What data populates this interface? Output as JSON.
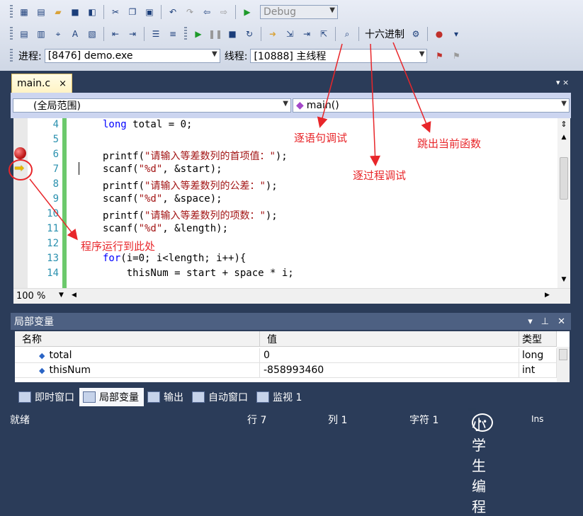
{
  "toolbar": {
    "config_value": "Debug",
    "hex_label": "十六进制",
    "process_label": "进程:",
    "process_value": "[8476] demo.exe",
    "thread_label": "线程:",
    "thread_value": "[10888] 主线程"
  },
  "editor": {
    "tab_label": "main.c",
    "tab_close": "×",
    "scope_value": "(全局范围)",
    "function_value": "main()",
    "zoom": "100 %",
    "lines": [
      {
        "n": "4",
        "code": "long total = 0;"
      },
      {
        "n": "5",
        "code": ""
      },
      {
        "n": "6",
        "code": "printf(\"请输入等差数列的首项值：\");"
      },
      {
        "n": "7",
        "code": "scanf(\"%d\", &start);"
      },
      {
        "n": "8",
        "code": "printf(\"请输入等差数列的公差：\");"
      },
      {
        "n": "9",
        "code": "scanf(\"%d\", &space);"
      },
      {
        "n": "10",
        "code": "printf(\"请输入等差数列的项数：\");"
      },
      {
        "n": "11",
        "code": "scanf(\"%d\", &length);"
      },
      {
        "n": "12",
        "code": ""
      },
      {
        "n": "13",
        "code": "for(i=0; i<length; i++){"
      },
      {
        "n": "14",
        "code": "    thisNum = start + space * i;"
      }
    ]
  },
  "annotations": {
    "step_into": "逐语句调试",
    "step_over": "逐过程调试",
    "step_out": "跳出当前函数",
    "run_to_here": "程序运行到此处"
  },
  "locals": {
    "title": "局部变量",
    "col_name": "名称",
    "col_value": "值",
    "col_type": "类型",
    "rows": [
      {
        "name": "total",
        "value": "0",
        "type": "long"
      },
      {
        "name": "thisNum",
        "value": "-858993460",
        "type": "int"
      }
    ]
  },
  "bottom_tabs": [
    "即时窗口",
    "局部变量",
    "输出",
    "自动窗口",
    "监视 1"
  ],
  "status": {
    "ready": "就绪",
    "line": "行 7",
    "col": "列 1",
    "char": "字符 1",
    "ins": "Ins",
    "watermark": "小学生编程"
  },
  "colors": {
    "annotation": "#e8262a",
    "chrome_bg": "#2b3c59",
    "keyword": "#0000ff",
    "string": "#a31515"
  }
}
